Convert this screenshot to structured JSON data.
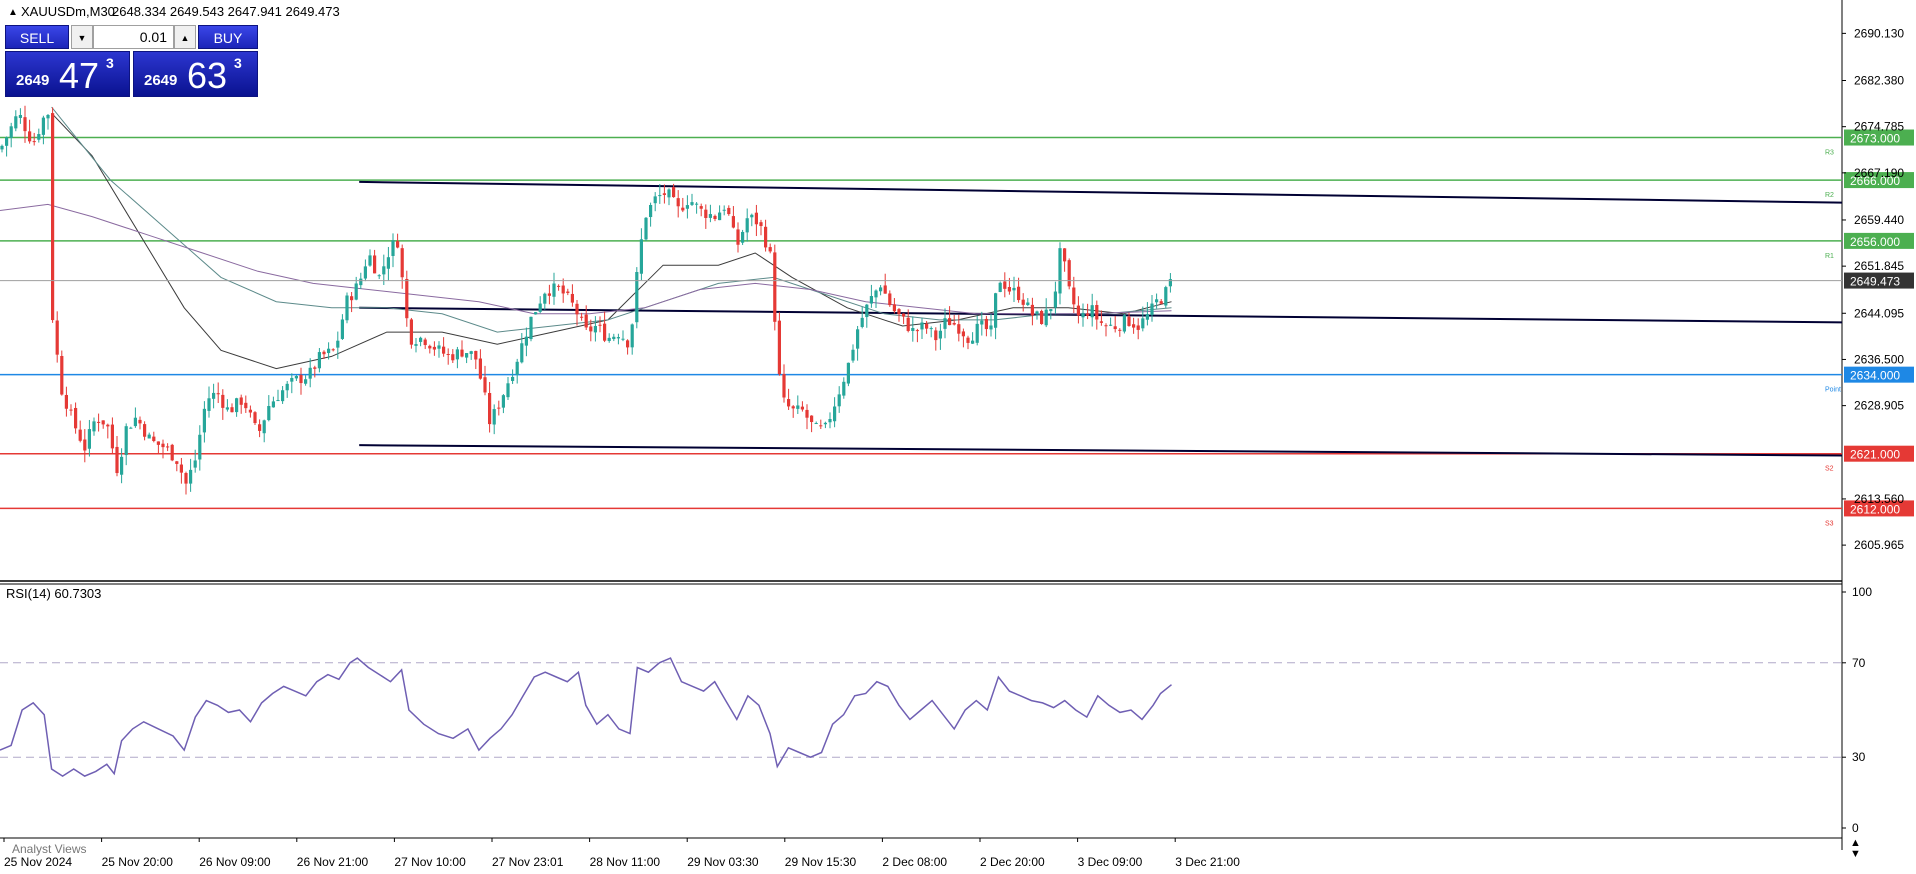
{
  "header": {
    "symbol_info": "XAUUSDm,M30",
    "ohlc": "2648.334 2649.543 2647.941 2649.473"
  },
  "one_click_trading": {
    "sell_label": "SELL",
    "buy_label": "BUY",
    "volume": "0.01",
    "sell_price": {
      "prefix": "2649",
      "big": "47",
      "sup": "3"
    },
    "buy_price": {
      "prefix": "2649",
      "big": "63",
      "sup": "3"
    }
  },
  "indicator_window": {
    "label": "RSI(14) 60.7303"
  },
  "tab_label": "Analyst Views",
  "colors": {
    "bull": "#26a69a",
    "bear": "#e53935",
    "resistance": "#4caf50",
    "support": "#e53935",
    "pivot": "#1e88e5",
    "channel": "#000033",
    "rsi": "#6f5fb3",
    "bid_label": "#333333"
  },
  "chart_data": [
    {
      "type": "candlestick",
      "symbol": "XAUUSDm",
      "timeframe": "M30",
      "ylim": [
        2602.2,
        2692.0
      ],
      "y_ticks": [
        "2690.130",
        "2682.380",
        "2674.785",
        "2667.190",
        "2659.440",
        "2651.845",
        "2644.095",
        "2636.500",
        "2628.905",
        "2613.560",
        "2605.965"
      ],
      "x_ticks": [
        "25 Nov 2024",
        "25 Nov 20:00",
        "26 Nov 09:00",
        "26 Nov 21:00",
        "27 Nov 10:00",
        "27 Nov 23:01",
        "28 Nov 11:00",
        "29 Nov 03:30",
        "29 Nov 15:30",
        "2 Dec 08:00",
        "2 Dec 20:00",
        "3 Dec 09:00",
        "3 Dec 21:00"
      ],
      "bid": {
        "value": 2649.473,
        "label": "2649.473"
      },
      "levels": [
        {
          "name": "R3",
          "value": 2673.0,
          "label": "2673.000",
          "kind": "resistance"
        },
        {
          "name": "R2",
          "value": 2666.0,
          "label": "2666.000",
          "kind": "resistance"
        },
        {
          "name": "R1",
          "value": 2656.0,
          "label": "2656.000",
          "kind": "resistance"
        },
        {
          "name": "Point",
          "value": 2634.0,
          "label": "2634.000",
          "kind": "pivot"
        },
        {
          "name": "S2",
          "value": 2621.0,
          "label": "2621.000",
          "kind": "support"
        },
        {
          "name": "S3",
          "value": 2612.0,
          "label": "2612.000",
          "kind": "support"
        }
      ],
      "channel": [
        {
          "x1": 0.195,
          "y1": 2665.7,
          "x2": 1.0,
          "y2": 2662.3
        },
        {
          "x1": 0.195,
          "y1": 2645.0,
          "x2": 1.0,
          "y2": 2642.6
        },
        {
          "x1": 0.195,
          "y1": 2622.4,
          "x2": 1.0,
          "y2": 2620.7
        }
      ],
      "close_path": [
        [
          0.0,
          2671
        ],
        [
          0.01,
          2677
        ],
        [
          0.018,
          2672
        ],
        [
          0.026,
          2678
        ],
        [
          0.028,
          2645
        ],
        [
          0.033,
          2632
        ],
        [
          0.04,
          2626
        ],
        [
          0.046,
          2622
        ],
        [
          0.052,
          2627
        ],
        [
          0.058,
          2626
        ],
        [
          0.064,
          2618
        ],
        [
          0.068,
          2625
        ],
        [
          0.074,
          2627
        ],
        [
          0.082,
          2623
        ],
        [
          0.09,
          2622
        ],
        [
          0.096,
          2620
        ],
        [
          0.101,
          2616
        ],
        [
          0.106,
          2620
        ],
        [
          0.112,
          2630
        ],
        [
          0.118,
          2631
        ],
        [
          0.124,
          2628
        ],
        [
          0.132,
          2630
        ],
        [
          0.14,
          2624
        ],
        [
          0.146,
          2629
        ],
        [
          0.152,
          2631
        ],
        [
          0.16,
          2633
        ],
        [
          0.168,
          2634
        ],
        [
          0.174,
          2637
        ],
        [
          0.182,
          2638
        ],
        [
          0.188,
          2646
        ],
        [
          0.195,
          2649
        ],
        [
          0.2,
          2654
        ],
        [
          0.206,
          2650
        ],
        [
          0.212,
          2655
        ],
        [
          0.216,
          2656
        ],
        [
          0.222,
          2640
        ],
        [
          0.23,
          2640
        ],
        [
          0.238,
          2638
        ],
        [
          0.244,
          2637
        ],
        [
          0.252,
          2638
        ],
        [
          0.258,
          2637
        ],
        [
          0.262,
          2632
        ],
        [
          0.266,
          2626
        ],
        [
          0.272,
          2630
        ],
        [
          0.28,
          2636
        ],
        [
          0.288,
          2643
        ],
        [
          0.296,
          2648
        ],
        [
          0.304,
          2648
        ],
        [
          0.312,
          2645
        ],
        [
          0.318,
          2641
        ],
        [
          0.324,
          2642
        ],
        [
          0.33,
          2640
        ],
        [
          0.336,
          2641
        ],
        [
          0.342,
          2639
        ],
        [
          0.346,
          2651
        ],
        [
          0.35,
          2660
        ],
        [
          0.356,
          2663
        ],
        [
          0.362,
          2664
        ],
        [
          0.368,
          2661
        ],
        [
          0.374,
          2663
        ],
        [
          0.38,
          2661
        ],
        [
          0.388,
          2660
        ],
        [
          0.394,
          2662
        ],
        [
          0.4,
          2655
        ],
        [
          0.406,
          2660
        ],
        [
          0.412,
          2659
        ],
        [
          0.418,
          2654
        ],
        [
          0.424,
          2630
        ],
        [
          0.43,
          2628
        ],
        [
          0.436,
          2628
        ],
        [
          0.442,
          2625
        ],
        [
          0.448,
          2625
        ],
        [
          0.454,
          2630
        ],
        [
          0.46,
          2635
        ],
        [
          0.466,
          2642
        ],
        [
          0.472,
          2646
        ],
        [
          0.478,
          2649
        ],
        [
          0.484,
          2645
        ],
        [
          0.49,
          2643
        ],
        [
          0.496,
          2641
        ],
        [
          0.502,
          2642
        ],
        [
          0.508,
          2640
        ],
        [
          0.514,
          2643
        ],
        [
          0.52,
          2642
        ],
        [
          0.526,
          2640
        ],
        [
          0.532,
          2642
        ],
        [
          0.538,
          2641
        ],
        [
          0.542,
          2650
        ],
        [
          0.548,
          2648
        ],
        [
          0.554,
          2647
        ],
        [
          0.56,
          2644
        ],
        [
          0.566,
          2643
        ],
        [
          0.572,
          2646
        ],
        [
          0.576,
          2655
        ],
        [
          0.58,
          2648
        ],
        [
          0.586,
          2643
        ],
        [
          0.592,
          2645
        ],
        [
          0.596,
          2643
        ],
        [
          0.6,
          2642
        ],
        [
          0.606,
          2642
        ],
        [
          0.612,
          2643
        ],
        [
          0.618,
          2642
        ],
        [
          0.624,
          2644
        ],
        [
          0.628,
          2646
        ],
        [
          0.632,
          2647
        ],
        [
          0.636,
          2649.5
        ]
      ],
      "ma_paths": [
        {
          "color": "#3b3b3b",
          "points": [
            [
              0.028,
              2677
            ],
            [
              0.05,
              2670
            ],
            [
              0.08,
              2655
            ],
            [
              0.1,
              2645
            ],
            [
              0.12,
              2638
            ],
            [
              0.15,
              2635
            ],
            [
              0.18,
              2637
            ],
            [
              0.21,
              2641
            ],
            [
              0.24,
              2641
            ],
            [
              0.27,
              2639
            ],
            [
              0.3,
              2641
            ],
            [
              0.33,
              2643
            ],
            [
              0.36,
              2652
            ],
            [
              0.39,
              2652
            ],
            [
              0.41,
              2654
            ],
            [
              0.43,
              2650
            ],
            [
              0.46,
              2645
            ],
            [
              0.49,
              2642
            ],
            [
              0.52,
              2643
            ],
            [
              0.55,
              2645
            ],
            [
              0.58,
              2645
            ],
            [
              0.61,
              2644
            ],
            [
              0.636,
              2646
            ]
          ]
        },
        {
          "color": "#5c8a8a",
          "points": [
            [
              0.028,
              2678
            ],
            [
              0.06,
              2666
            ],
            [
              0.09,
              2658
            ],
            [
              0.12,
              2650
            ],
            [
              0.15,
              2646
            ],
            [
              0.18,
              2645
            ],
            [
              0.21,
              2645
            ],
            [
              0.24,
              2644
            ],
            [
              0.27,
              2641
            ],
            [
              0.3,
              2642
            ],
            [
              0.33,
              2643
            ],
            [
              0.36,
              2646
            ],
            [
              0.39,
              2649
            ],
            [
              0.42,
              2650
            ],
            [
              0.45,
              2647
            ],
            [
              0.48,
              2644
            ],
            [
              0.51,
              2643
            ],
            [
              0.54,
              2643
            ],
            [
              0.57,
              2644
            ],
            [
              0.6,
              2644
            ],
            [
              0.636,
              2645
            ]
          ]
        },
        {
          "color": "#8a6aa0",
          "points": [
            [
              0.0,
              2661
            ],
            [
              0.026,
              2662
            ],
            [
              0.05,
              2660
            ],
            [
              0.08,
              2657
            ],
            [
              0.11,
              2654
            ],
            [
              0.14,
              2651
            ],
            [
              0.17,
              2649
            ],
            [
              0.2,
              2648
            ],
            [
              0.23,
              2647
            ],
            [
              0.26,
              2646
            ],
            [
              0.29,
              2644
            ],
            [
              0.32,
              2644
            ],
            [
              0.35,
              2645
            ],
            [
              0.38,
              2648
            ],
            [
              0.41,
              2649
            ],
            [
              0.44,
              2648
            ],
            [
              0.47,
              2646
            ],
            [
              0.5,
              2645
            ],
            [
              0.53,
              2644
            ],
            [
              0.56,
              2644
            ],
            [
              0.59,
              2644
            ],
            [
              0.636,
              2644.5
            ]
          ]
        }
      ]
    },
    {
      "type": "line",
      "name": "RSI(14)",
      "value_label": "60.7303",
      "ylim": [
        0,
        100
      ],
      "y_ticks": [
        100,
        70,
        30,
        0
      ],
      "guides": [
        70,
        30
      ],
      "points": [
        [
          0.0,
          33
        ],
        [
          0.006,
          35
        ],
        [
          0.012,
          50
        ],
        [
          0.018,
          53
        ],
        [
          0.024,
          48
        ],
        [
          0.028,
          25
        ],
        [
          0.034,
          22
        ],
        [
          0.04,
          25
        ],
        [
          0.046,
          22
        ],
        [
          0.052,
          24
        ],
        [
          0.058,
          27
        ],
        [
          0.062,
          23
        ],
        [
          0.066,
          37
        ],
        [
          0.072,
          42
        ],
        [
          0.078,
          45
        ],
        [
          0.086,
          42
        ],
        [
          0.094,
          39
        ],
        [
          0.1,
          33
        ],
        [
          0.106,
          47
        ],
        [
          0.112,
          54
        ],
        [
          0.118,
          52
        ],
        [
          0.124,
          49
        ],
        [
          0.13,
          50
        ],
        [
          0.136,
          45
        ],
        [
          0.142,
          53
        ],
        [
          0.148,
          57
        ],
        [
          0.154,
          60
        ],
        [
          0.16,
          58
        ],
        [
          0.166,
          56
        ],
        [
          0.172,
          62
        ],
        [
          0.178,
          65
        ],
        [
          0.184,
          63
        ],
        [
          0.19,
          70
        ],
        [
          0.194,
          72
        ],
        [
          0.2,
          68
        ],
        [
          0.206,
          65
        ],
        [
          0.212,
          62
        ],
        [
          0.218,
          67
        ],
        [
          0.222,
          50
        ],
        [
          0.23,
          44
        ],
        [
          0.238,
          40
        ],
        [
          0.246,
          38
        ],
        [
          0.254,
          42
        ],
        [
          0.26,
          33
        ],
        [
          0.266,
          38
        ],
        [
          0.272,
          42
        ],
        [
          0.278,
          48
        ],
        [
          0.284,
          56
        ],
        [
          0.29,
          64
        ],
        [
          0.296,
          66
        ],
        [
          0.302,
          64
        ],
        [
          0.308,
          62
        ],
        [
          0.314,
          66
        ],
        [
          0.318,
          52
        ],
        [
          0.324,
          44
        ],
        [
          0.33,
          48
        ],
        [
          0.336,
          42
        ],
        [
          0.342,
          40
        ],
        [
          0.346,
          68
        ],
        [
          0.352,
          66
        ],
        [
          0.358,
          70
        ],
        [
          0.364,
          72
        ],
        [
          0.37,
          62
        ],
        [
          0.376,
          60
        ],
        [
          0.382,
          58
        ],
        [
          0.388,
          62
        ],
        [
          0.394,
          54
        ],
        [
          0.4,
          46
        ],
        [
          0.406,
          56
        ],
        [
          0.412,
          52
        ],
        [
          0.418,
          40
        ],
        [
          0.422,
          26
        ],
        [
          0.428,
          34
        ],
        [
          0.434,
          32
        ],
        [
          0.44,
          30
        ],
        [
          0.446,
          32
        ],
        [
          0.452,
          44
        ],
        [
          0.458,
          48
        ],
        [
          0.464,
          56
        ],
        [
          0.47,
          57
        ],
        [
          0.476,
          62
        ],
        [
          0.482,
          60
        ],
        [
          0.488,
          52
        ],
        [
          0.494,
          46
        ],
        [
          0.5,
          50
        ],
        [
          0.506,
          54
        ],
        [
          0.512,
          48
        ],
        [
          0.518,
          42
        ],
        [
          0.524,
          50
        ],
        [
          0.53,
          54
        ],
        [
          0.536,
          50
        ],
        [
          0.542,
          64
        ],
        [
          0.548,
          58
        ],
        [
          0.554,
          56
        ],
        [
          0.56,
          54
        ],
        [
          0.566,
          53
        ],
        [
          0.572,
          51
        ],
        [
          0.578,
          54
        ],
        [
          0.584,
          50
        ],
        [
          0.59,
          47
        ],
        [
          0.596,
          56
        ],
        [
          0.602,
          52
        ],
        [
          0.608,
          49
        ],
        [
          0.614,
          50
        ],
        [
          0.62,
          46
        ],
        [
          0.626,
          52
        ],
        [
          0.63,
          57
        ],
        [
          0.636,
          60.7
        ]
      ]
    }
  ]
}
